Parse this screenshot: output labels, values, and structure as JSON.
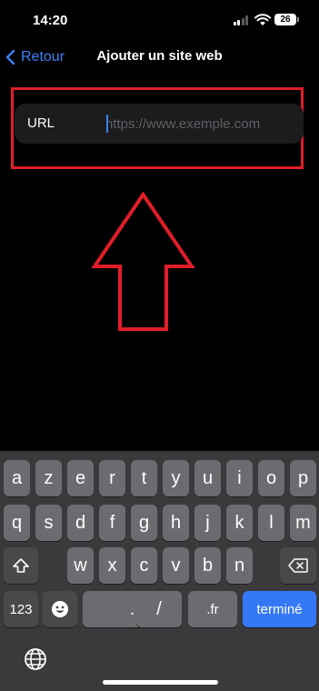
{
  "status_bar": {
    "time": "14:20",
    "battery": "26"
  },
  "nav": {
    "back_label": "Retour",
    "title": "Ajouter un site web"
  },
  "form": {
    "url_label": "URL",
    "url_placeholder": "https://www.exemple.com",
    "url_value": ""
  },
  "keyboard": {
    "row1": [
      "a",
      "z",
      "e",
      "r",
      "t",
      "y",
      "u",
      "i",
      "o",
      "p"
    ],
    "row2": [
      "q",
      "s",
      "d",
      "f",
      "g",
      "h",
      "j",
      "k",
      "l",
      "m"
    ],
    "row3": [
      "w",
      "x",
      "c",
      "v",
      "b",
      "n"
    ],
    "numbers_key": "123",
    "dot_key": ".",
    "slash_key": "/",
    "domain_key": ".fr",
    "done_key": "terminé"
  },
  "colors": {
    "accent": "#3b82f6",
    "highlight": "#e11d2a",
    "done_key": "#3478f6"
  },
  "icons": [
    "chevron-left-icon",
    "wifi-icon",
    "battery-icon",
    "shift-icon",
    "delete-icon",
    "emoji-icon",
    "globe-icon",
    "arrow-up-annotation"
  ]
}
